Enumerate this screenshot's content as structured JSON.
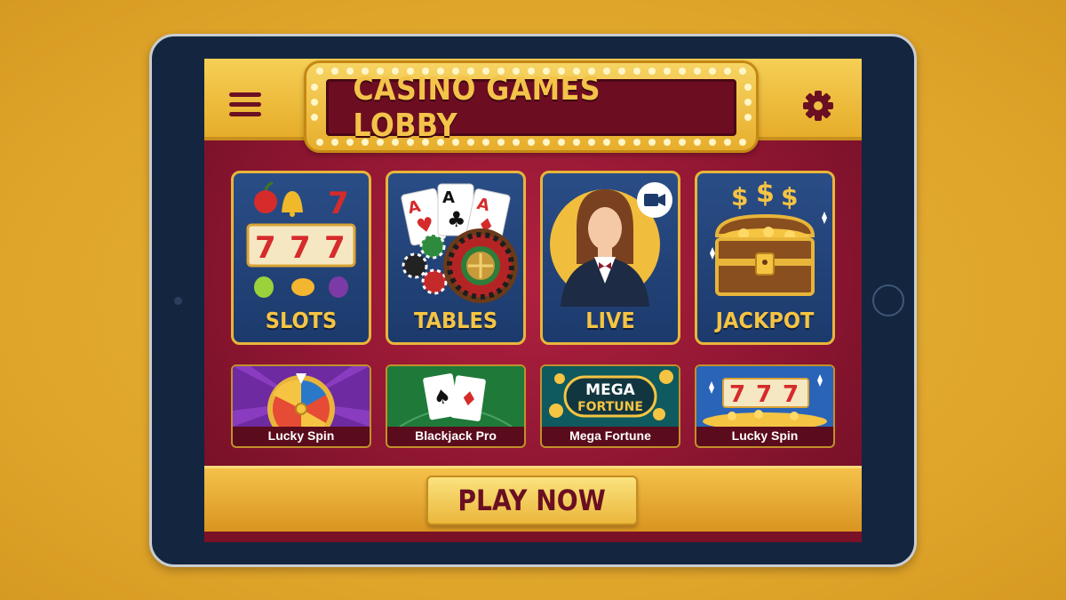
{
  "header": {
    "title": "CASINO GAMES LOBBY",
    "menu_icon": "hamburger-menu-icon",
    "settings_icon": "gear-icon"
  },
  "categories": [
    {
      "label": "SLOTS",
      "icon": "slot-reels-icon"
    },
    {
      "label": "TABLES",
      "icon": "cards-roulette-icon"
    },
    {
      "label": "LIVE",
      "icon": "live-dealer-icon"
    },
    {
      "label": "JACKPOT",
      "icon": "treasure-chest-icon"
    }
  ],
  "games": [
    {
      "label": "Lucky Spin",
      "thumb": "prize-wheel"
    },
    {
      "label": "Blackjack Pro",
      "thumb": "blackjack-cards"
    },
    {
      "label": "Mega Fortune",
      "thumb": "mega-fortune-banner",
      "banner_line1": "MEGA",
      "banner_line2": "FORTUNE"
    },
    {
      "label": "Lucky Spin",
      "thumb": "777-coins"
    }
  ],
  "footer": {
    "play_label": "PLAY NOW"
  },
  "art_text": {
    "seven": "7",
    "dollar": "$",
    "ace": "A"
  },
  "colors": {
    "gold": "#f5c443",
    "maroon": "#6d0d22",
    "navy": "#1c3a6c",
    "bezel": "#14263f"
  }
}
